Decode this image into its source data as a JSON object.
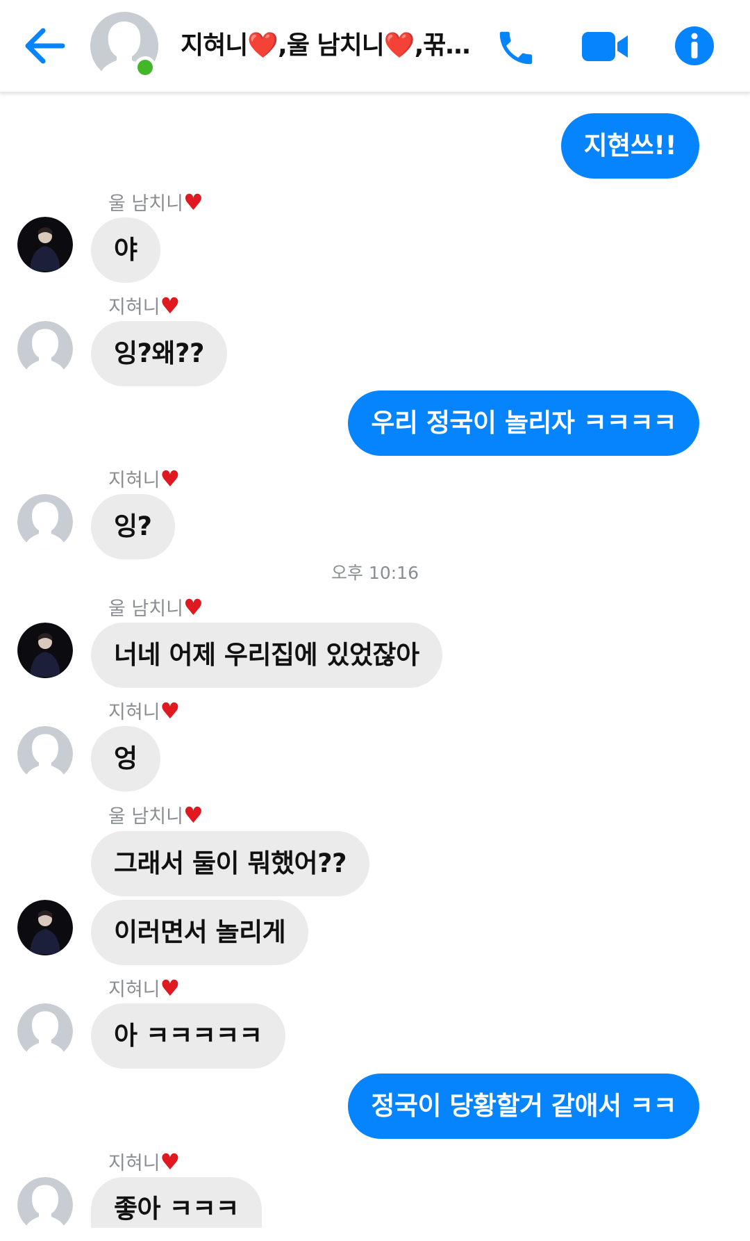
{
  "header": {
    "title": "지혀니❤️,울 남치니❤️,꾺…",
    "online": true
  },
  "icons": {
    "back": "back-arrow-icon",
    "call": "phone-icon",
    "video": "video-camera-icon",
    "info": "info-icon"
  },
  "colors": {
    "accent": "#0584fe",
    "incoming_bubble": "#ebebeb",
    "online": "#42b72a",
    "heart": "#e0181f"
  },
  "messages": {
    "m1": {
      "text": "지현쓰!!",
      "direction": "outgoing"
    },
    "m2": {
      "sender": "울 남치니",
      "text": "야",
      "direction": "incoming"
    },
    "m3": {
      "sender": "지혀니",
      "text": "잉?왜??",
      "direction": "incoming"
    },
    "m4": {
      "text": "우리 정국이 놀리자 ㅋㅋㅋㅋ",
      "direction": "outgoing"
    },
    "m5": {
      "sender": "지혀니",
      "text": "잉?",
      "direction": "incoming"
    },
    "ts1": {
      "text": "오후 10:16"
    },
    "m6": {
      "sender": "울 남치니",
      "text": "너네 어제 우리집에 있었잖아",
      "direction": "incoming"
    },
    "m7": {
      "sender": "지혀니",
      "text": "엉",
      "direction": "incoming"
    },
    "m8": {
      "sender": "울 남치니",
      "text": "그래서 둘이 뭐했어??",
      "direction": "incoming"
    },
    "m9": {
      "text": "이러면서 놀리게",
      "direction": "incoming"
    },
    "m10": {
      "sender": "지혀니",
      "text": "아 ㅋㅋㅋㅋㅋ",
      "direction": "incoming"
    },
    "m11": {
      "text": "정국이 당황할거 같애서 ㅋㅋ",
      "direction": "outgoing"
    },
    "m12": {
      "sender": "지혀니",
      "text": "좋아 ㅋㅋㅋ",
      "direction": "incoming"
    }
  }
}
